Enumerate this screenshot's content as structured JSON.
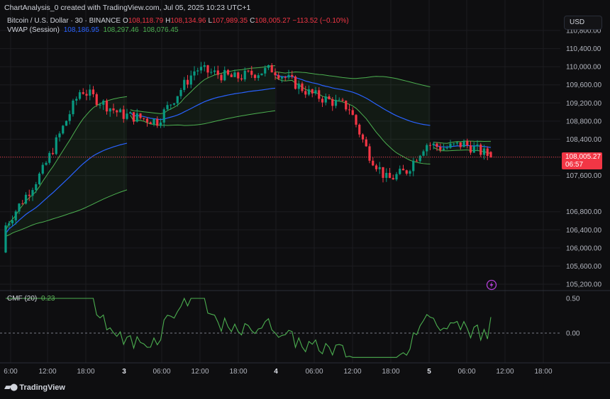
{
  "header": {
    "text": "ChartAnalysis_0 created with TradingView.com, Jul 05, 2025 10:23 UTC+1"
  },
  "legend": {
    "symbol": "Bitcoin / U.S. Dollar · 30 · BINANCE",
    "o_label": "O",
    "o_value": "108,118.79",
    "h_label": "H",
    "h_value": "108,134.96",
    "l_label": "L",
    "l_value": "107,989.35",
    "c_label": "C",
    "c_value": "108,005.27",
    "change": "−113.52 (−0.10%)",
    "vwap_label": "VWAP (Session)",
    "vwap_v1": "108,186.95",
    "vwap_v2": "108,297.46",
    "vwap_v3": "108,076.45",
    "cmf_label": "CMF (20)",
    "cmf_value": "0.23"
  },
  "currency_button": "USD",
  "price_tag": {
    "price": "108,005.27",
    "countdown": "06:57"
  },
  "branding": {
    "logo_text": "TradingView",
    "logo_icon": "tradingview-logo-icon"
  },
  "icons": {
    "bolt": "lightning-bolt-icon"
  },
  "colors": {
    "background": "#0e0e10",
    "bull": "#089981",
    "bear": "#f23645",
    "vwap": "#2962ff",
    "band": "#4caf50",
    "cmf": "#4caf50",
    "grid": "#1c1c20",
    "text": "#d1d4dc",
    "bolt": "#b33fd6"
  },
  "chart_data": [
    {
      "type": "candlestick",
      "title": "Bitcoin / U.S. Dollar · 30 · BINANCE",
      "x_unit": "time (30-minute bars)",
      "y_ticks": [
        110800,
        110400,
        110000,
        109600,
        109200,
        108800,
        108400,
        108000,
        107600,
        106800,
        106400,
        106000,
        105600,
        105200
      ],
      "ylim": [
        105050,
        110950
      ],
      "x_ticks": [
        "6:00",
        "12:00",
        "18:00",
        "3",
        "06:00",
        "12:00",
        "18:00",
        "4",
        "06:00",
        "12:00",
        "18:00",
        "5",
        "06:00",
        "12:00",
        "18:00"
      ],
      "last_price": 108005.27,
      "anchor_points": [
        {
          "t": "Jul 2 06:00",
          "close": 106500
        },
        {
          "t": "Jul 2 12:00",
          "close": 107700
        },
        {
          "t": "Jul 2 18:00",
          "close": 109500
        },
        {
          "t": "Jul 3 00:00",
          "close": 108950
        },
        {
          "t": "Jul 3 06:00",
          "close": 108800
        },
        {
          "t": "Jul 3 12:00",
          "close": 109950
        },
        {
          "t": "Jul 3 18:00",
          "close": 109750
        },
        {
          "t": "Jul 4 00:00",
          "close": 109950
        },
        {
          "t": "Jul 4 06:00",
          "close": 109400
        },
        {
          "t": "Jul 4 12:00",
          "close": 109100
        },
        {
          "t": "Jul 4 15:00",
          "close": 108100
        },
        {
          "t": "Jul 4 18:00",
          "close": 107500
        },
        {
          "t": "Jul 4 21:00",
          "close": 107700
        },
        {
          "t": "Jul 5 00:00",
          "close": 108300
        },
        {
          "t": "Jul 5 03:00",
          "close": 108200
        },
        {
          "t": "Jul 5 06:00",
          "close": 108300
        },
        {
          "t": "Jul 5 10:00",
          "close": 108005
        }
      ],
      "series": [
        {
          "name": "VWAP (Session)",
          "values": [
            108186.95,
            108297.46,
            108076.45
          ]
        }
      ]
    },
    {
      "type": "line",
      "title": "CMF (20)",
      "y_ticks": [
        0.5,
        0.0
      ],
      "ylim": [
        -0.42,
        0.55
      ],
      "last_value": 0.23
    }
  ]
}
